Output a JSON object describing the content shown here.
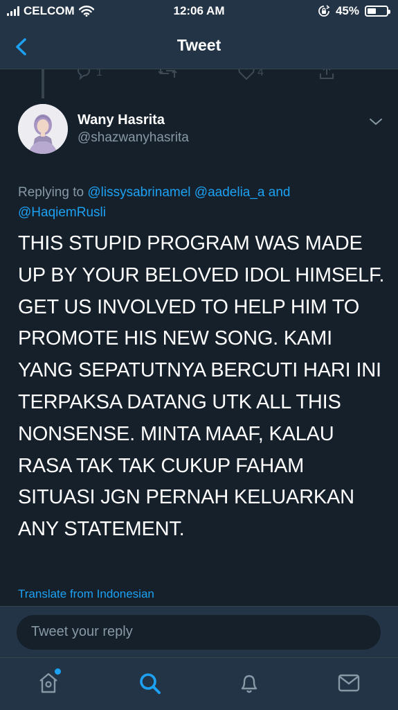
{
  "status_bar": {
    "carrier": "CELCOM",
    "time": "12:06 AM",
    "battery_percent": "45%",
    "battery_level": 0.45
  },
  "nav": {
    "title": "Tweet",
    "back_icon": "chevron-left-icon"
  },
  "previous_tweet_actions": {
    "reply_count": "1",
    "like_count": "4"
  },
  "tweet": {
    "author_name": "Wany Hasrita",
    "author_handle": "@shazwanyhasrita",
    "replying_prefix": "Replying to ",
    "mention_1": "@lissysabrinamel",
    "mention_2": "@aadelia_a",
    "mention_joiner": " and",
    "mention_3": "@HaqiemRusli",
    "body": "THIS STUPID PROGRAM WAS MADE UP BY YOUR BELOVED IDOL HIMSELF. GET US INVOLVED TO HELP HIM TO PROMOTE HIS NEW SONG. KAMI YANG SEPATUTNYA BERCUTI HARI INI TERPAKSA DATANG UTK ALL THIS NONSENSE. MINTA MAAF, KALAU RASA TAK TAK CUKUP FAHAM SITUASI JGN PERNAH KELUARKAN ANY STATEMENT.",
    "translate_label": "Translate from Indonesian"
  },
  "reply": {
    "placeholder": "Tweet your reply"
  },
  "tabs": [
    {
      "name": "home",
      "icon": "home-icon"
    },
    {
      "name": "search",
      "icon": "search-icon"
    },
    {
      "name": "notifications",
      "icon": "bell-icon"
    },
    {
      "name": "messages",
      "icon": "mail-icon"
    }
  ],
  "colors": {
    "background": "#15202b",
    "bar": "#243447",
    "accent": "#1da1f2",
    "secondary_text": "#8899a6"
  }
}
